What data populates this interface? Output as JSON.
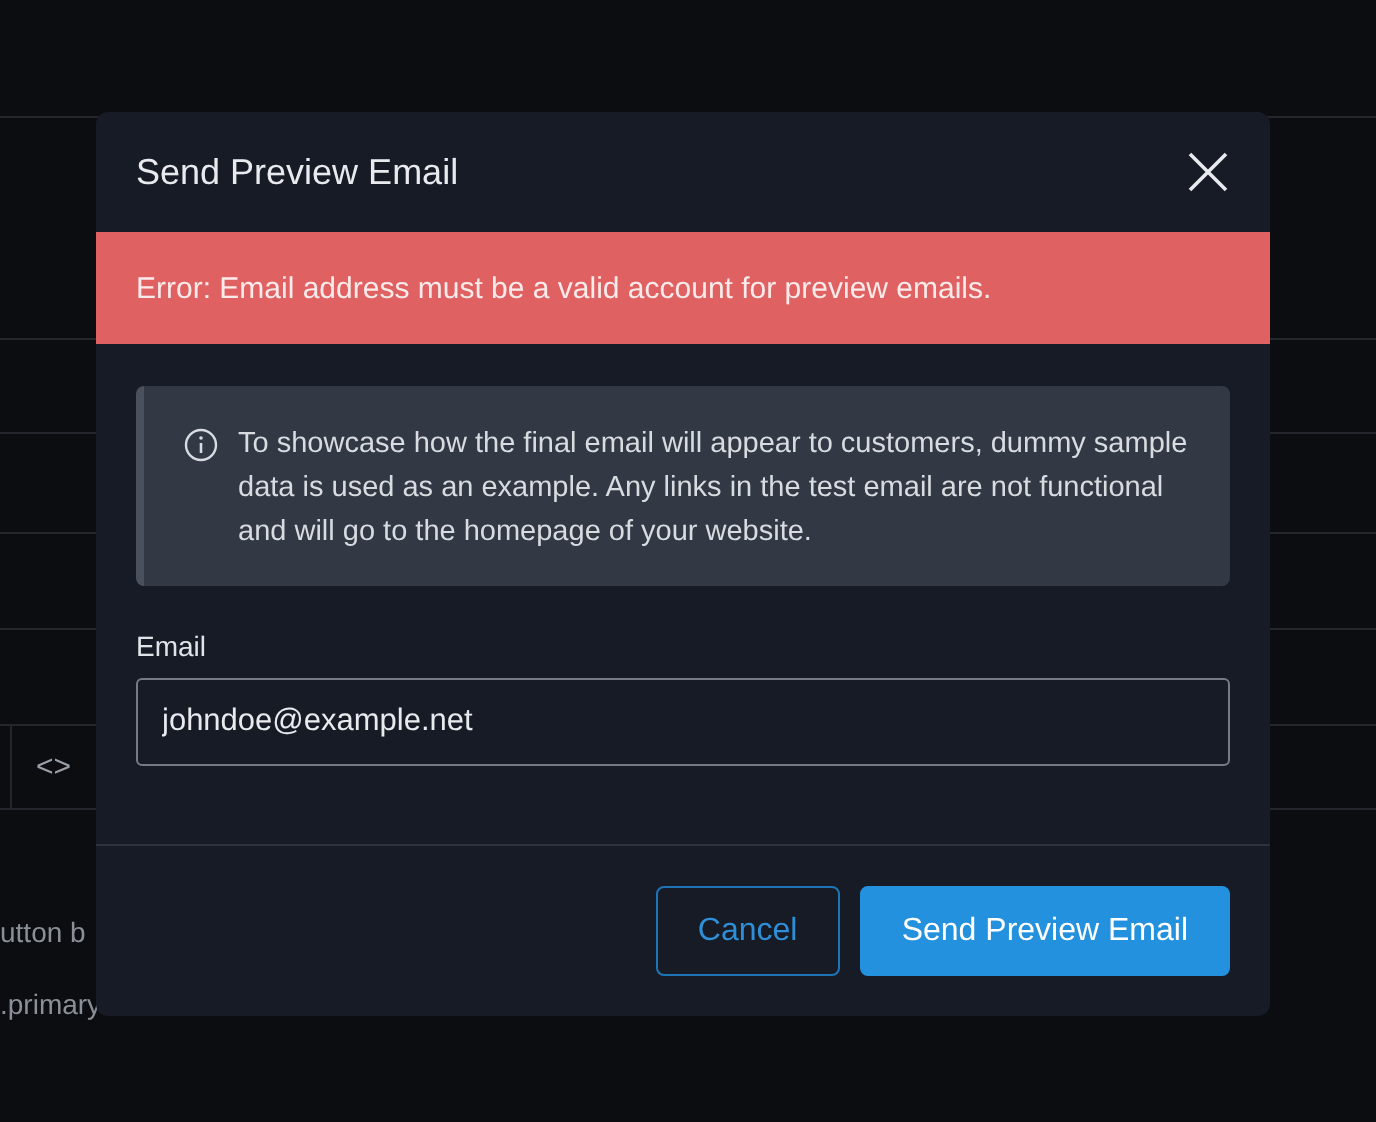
{
  "background": {
    "code_toggle": "<>",
    "texts": [
      "utton b",
      ".primary"
    ]
  },
  "dialog": {
    "title": "Send Preview Email",
    "error": "Error: Email address must be a valid account for preview emails.",
    "info": "To showcase how the final email will appear to customers, dummy sample data is used as an example. Any links in the test email are not functional and will go to the homepage of your website.",
    "email_label": "Email",
    "email_value": "johndoe@example.net",
    "buttons": [
      {
        "label": "Cancel",
        "kind": "secondary"
      },
      {
        "label": "Send Preview Email",
        "kind": "primary"
      }
    ]
  }
}
